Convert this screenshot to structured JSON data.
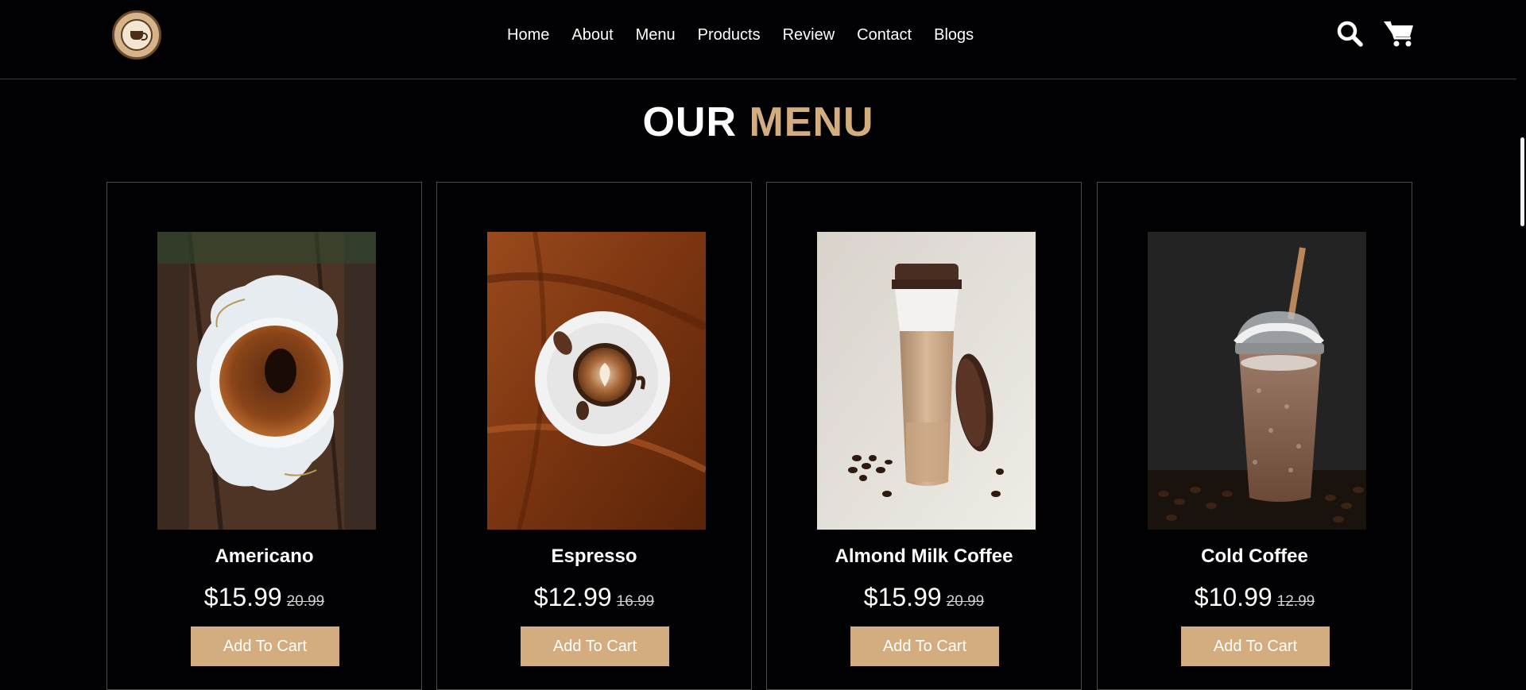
{
  "header": {
    "logo_text": "COFFEE SHOP",
    "nav": [
      "Home",
      "About",
      "Menu",
      "Products",
      "Review",
      "Contact",
      "Blogs"
    ],
    "icons": [
      "search-icon",
      "cart-icon"
    ]
  },
  "section": {
    "title_part1": "OUR",
    "title_part2": "MENU"
  },
  "menu": [
    {
      "name": "Americano",
      "price": "$15.99",
      "old_price": "20.99",
      "button": "Add To Cart"
    },
    {
      "name": "Espresso",
      "price": "$12.99",
      "old_price": "16.99",
      "button": "Add To Cart"
    },
    {
      "name": "Almond Milk Coffee",
      "price": "$15.99",
      "old_price": "20.99",
      "button": "Add To Cart"
    },
    {
      "name": "Cold Coffee",
      "price": "$10.99",
      "old_price": "12.99",
      "button": "Add To Cart"
    }
  ],
  "colors": {
    "background": "#010103",
    "accent": "#d3ad7f",
    "text": "#ffffff"
  }
}
